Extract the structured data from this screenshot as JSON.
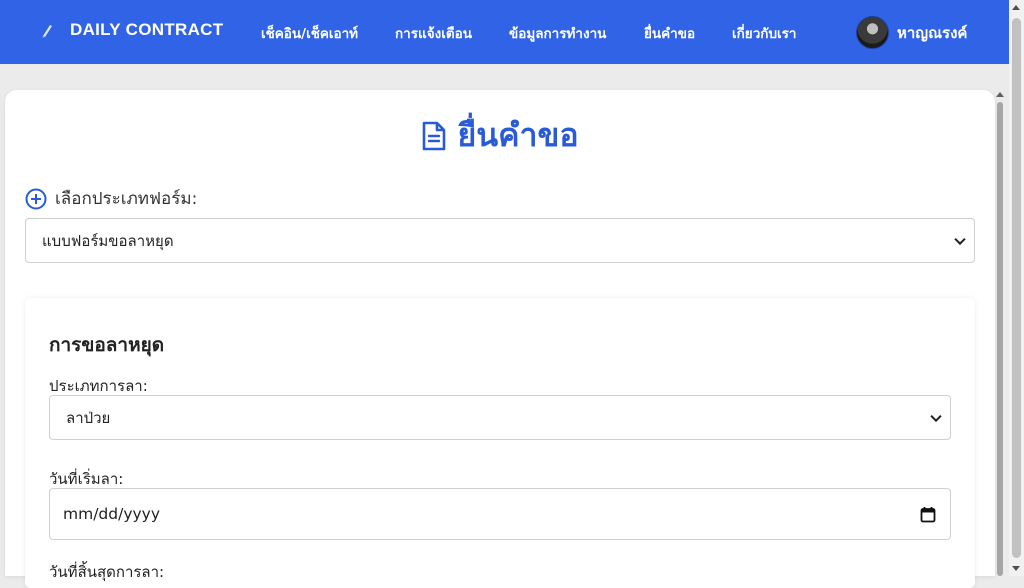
{
  "nav": {
    "brand": "DAILY CONTRACT",
    "items": [
      {
        "label": "เช็คอิน/เช็คเอาท์"
      },
      {
        "label": "การแจ้งเตือน"
      },
      {
        "label": "ข้อมูลการทำงาน"
      },
      {
        "label": "ยื่นคำขอ"
      },
      {
        "label": "เกี่ยวกับเรา"
      }
    ],
    "user_name": "หาญณรงค์"
  },
  "page": {
    "title": "ยื่นคำขอ",
    "form_type_label": "เลือกประเภทฟอร์ม:",
    "form_type_value": "แบบฟอร์มขอลาหยุด"
  },
  "leave_form": {
    "title": "การขอลาหยุด",
    "leave_type_label": "ประเภทการลา:",
    "leave_type_value": "ลาป่วย",
    "start_date_label": "วันที่เริ่มลา:",
    "start_date_value": "mm/dd/yyyy",
    "end_date_label": "วันที่สิ้นสุดการลา:"
  },
  "colors": {
    "nav_bg": "#3163e6",
    "accent": "#2a5bd7"
  }
}
